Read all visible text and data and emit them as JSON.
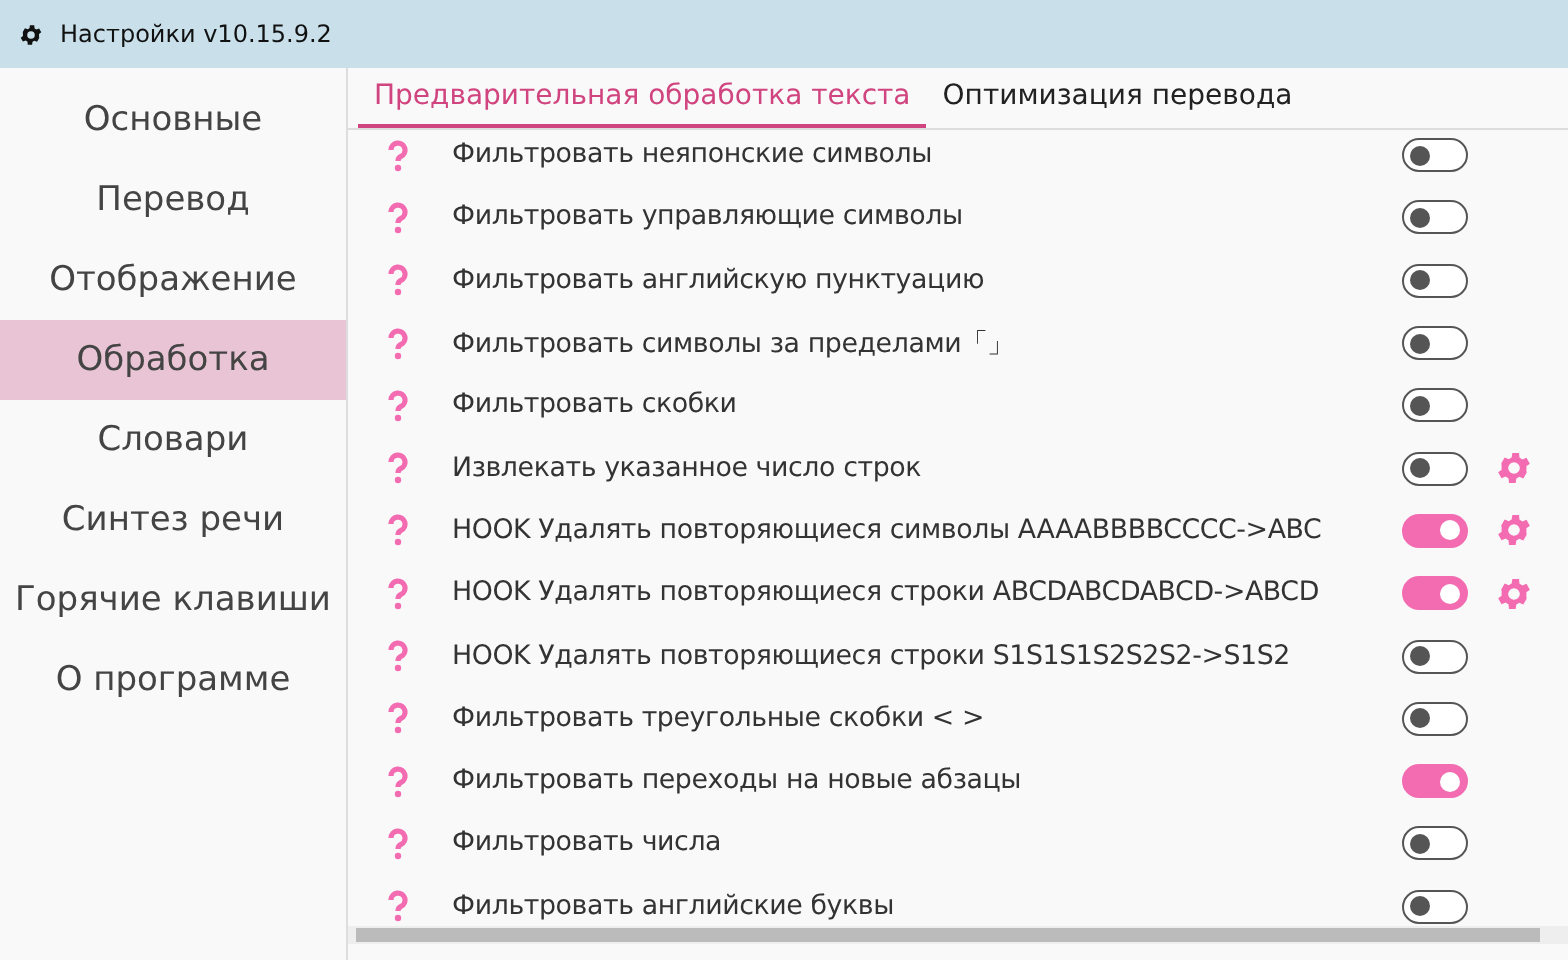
{
  "window": {
    "title": "Настройки v10.15.9.2"
  },
  "sidebar": {
    "items": [
      {
        "label": "Основные",
        "selected": false
      },
      {
        "label": "Перевод",
        "selected": false
      },
      {
        "label": "Отображение",
        "selected": false
      },
      {
        "label": "Обработка",
        "selected": true
      },
      {
        "label": "Словари",
        "selected": false
      },
      {
        "label": "Синтез речи",
        "selected": false
      },
      {
        "label": "Горячие клавиши",
        "selected": false
      },
      {
        "label": "О программе",
        "selected": false
      }
    ]
  },
  "tabs": [
    {
      "label": "Предварительная обработка текста",
      "selected": true
    },
    {
      "label": "Оптимизация перевода",
      "selected": false
    }
  ],
  "options": [
    {
      "label": "Фильтровать неяпонские символы",
      "on": false,
      "settings": false
    },
    {
      "label": "Фильтровать управляющие символы",
      "on": false,
      "settings": false
    },
    {
      "label": "Фильтровать английскую пунктуацию",
      "on": false,
      "settings": false
    },
    {
      "label": "Фильтровать символы за пределами「」",
      "on": false,
      "settings": false
    },
    {
      "label": "Фильтровать скобки",
      "on": false,
      "settings": false
    },
    {
      "label": "Извлекать указанное число строк",
      "on": false,
      "settings": true
    },
    {
      "label": "HOOK Удалять повторяющиеся символы AAAABBBBCCCC->ABC",
      "on": true,
      "settings": true
    },
    {
      "label": "HOOK Удалять повторяющиеся строки ABCDABCDABCD->ABCD",
      "on": true,
      "settings": true
    },
    {
      "label": "HOOK Удалять повторяющиеся строки S1S1S1S2S2S2->S1S2",
      "on": false,
      "settings": false
    },
    {
      "label": "Фильтровать треугольные скобки < >",
      "on": false,
      "settings": false
    },
    {
      "label": "Фильтровать переходы на новые абзацы",
      "on": true,
      "settings": false
    },
    {
      "label": "Фильтровать числа",
      "on": false,
      "settings": false
    },
    {
      "label": "Фильтровать английские буквы",
      "on": false,
      "settings": false
    }
  ]
}
